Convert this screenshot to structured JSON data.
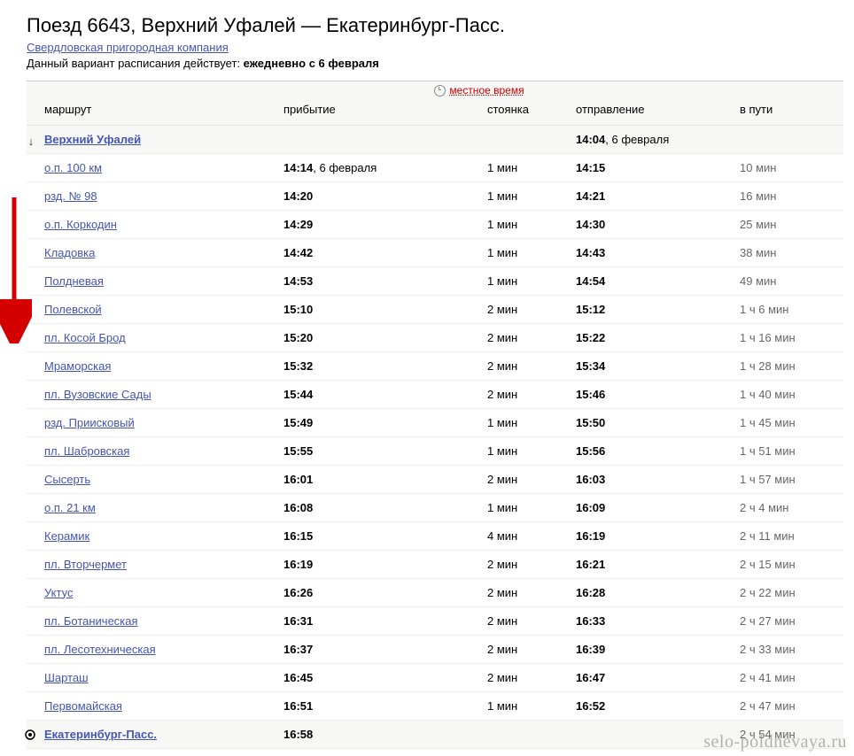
{
  "title": "Поезд 6643, Верхний Уфалей — Екатеринбург-Пасс.",
  "company": "Свердловская пригородная компания",
  "schedule_note_prefix": "Данный вариант расписания действует: ",
  "schedule_note_bold": "ежедневно с 6 февраля",
  "localtime_label": "местное время",
  "headers": {
    "route": "маршрут",
    "arrival": "прибытие",
    "stop": "стоянка",
    "departure": "отправление",
    "travel": "в пути"
  },
  "rows": [
    {
      "station": "Верхний Уфалей",
      "arrival_time": "",
      "arrival_date": "",
      "stop": "",
      "departure_time": "14:04",
      "departure_date": ", 6 февраля",
      "travel": "",
      "first": true
    },
    {
      "station": "о.п. 100 км",
      "arrival_time": "14:14",
      "arrival_date": ", 6 февраля",
      "stop": "1 мин",
      "departure_time": "14:15",
      "departure_date": "",
      "travel": "10 мин"
    },
    {
      "station": "рзд. № 98",
      "arrival_time": "14:20",
      "arrival_date": "",
      "stop": "1 мин",
      "departure_time": "14:21",
      "departure_date": "",
      "travel": "16 мин"
    },
    {
      "station": "о.п. Коркодин",
      "arrival_time": "14:29",
      "arrival_date": "",
      "stop": "1 мин",
      "departure_time": "14:30",
      "departure_date": "",
      "travel": "25 мин"
    },
    {
      "station": "Кладовка",
      "arrival_time": "14:42",
      "arrival_date": "",
      "stop": "1 мин",
      "departure_time": "14:43",
      "departure_date": "",
      "travel": "38 мин"
    },
    {
      "station": "Полдневая",
      "arrival_time": "14:53",
      "arrival_date": "",
      "stop": "1 мин",
      "departure_time": "14:54",
      "departure_date": "",
      "travel": "49 мин"
    },
    {
      "station": "Полевской",
      "arrival_time": "15:10",
      "arrival_date": "",
      "stop": "2 мин",
      "departure_time": "15:12",
      "departure_date": "",
      "travel": "1 ч 6 мин"
    },
    {
      "station": "пл. Косой Брод",
      "arrival_time": "15:20",
      "arrival_date": "",
      "stop": "2 мин",
      "departure_time": "15:22",
      "departure_date": "",
      "travel": "1 ч 16 мин"
    },
    {
      "station": "Мраморская",
      "arrival_time": "15:32",
      "arrival_date": "",
      "stop": "2 мин",
      "departure_time": "15:34",
      "departure_date": "",
      "travel": "1 ч 28 мин"
    },
    {
      "station": "пл. Вузовские Сады",
      "arrival_time": "15:44",
      "arrival_date": "",
      "stop": "2 мин",
      "departure_time": "15:46",
      "departure_date": "",
      "travel": "1 ч 40 мин"
    },
    {
      "station": "рзд. Приисковый",
      "arrival_time": "15:49",
      "arrival_date": "",
      "stop": "1 мин",
      "departure_time": "15:50",
      "departure_date": "",
      "travel": "1 ч 45 мин"
    },
    {
      "station": "пл. Шабровская",
      "arrival_time": "15:55",
      "arrival_date": "",
      "stop": "1 мин",
      "departure_time": "15:56",
      "departure_date": "",
      "travel": "1 ч 51 мин"
    },
    {
      "station": "Сысерть",
      "arrival_time": "16:01",
      "arrival_date": "",
      "stop": "2 мин",
      "departure_time": "16:03",
      "departure_date": "",
      "travel": "1 ч 57 мин"
    },
    {
      "station": "о.п. 21 км",
      "arrival_time": "16:08",
      "arrival_date": "",
      "stop": "1 мин",
      "departure_time": "16:09",
      "departure_date": "",
      "travel": "2 ч 4 мин"
    },
    {
      "station": "Керамик",
      "arrival_time": "16:15",
      "arrival_date": "",
      "stop": "4 мин",
      "departure_time": "16:19",
      "departure_date": "",
      "travel": "2 ч 11 мин"
    },
    {
      "station": "пл. Вторчермет",
      "arrival_time": "16:19",
      "arrival_date": "",
      "stop": "2 мин",
      "departure_time": "16:21",
      "departure_date": "",
      "travel": "2 ч 15 мин"
    },
    {
      "station": "Уктус",
      "arrival_time": "16:26",
      "arrival_date": "",
      "stop": "2 мин",
      "departure_time": "16:28",
      "departure_date": "",
      "travel": "2 ч 22 мин"
    },
    {
      "station": "пл. Ботаническая",
      "arrival_time": "16:31",
      "arrival_date": "",
      "stop": "2 мин",
      "departure_time": "16:33",
      "departure_date": "",
      "travel": "2 ч 27 мин"
    },
    {
      "station": "пл. Лесотехническая",
      "arrival_time": "16:37",
      "arrival_date": "",
      "stop": "2 мин",
      "departure_time": "16:39",
      "departure_date": "",
      "travel": "2 ч 33 мин"
    },
    {
      "station": "Шарташ",
      "arrival_time": "16:45",
      "arrival_date": "",
      "stop": "2 мин",
      "departure_time": "16:47",
      "departure_date": "",
      "travel": "2 ч 41 мин"
    },
    {
      "station": "Первомайская",
      "arrival_time": "16:51",
      "arrival_date": "",
      "stop": "1 мин",
      "departure_time": "16:52",
      "departure_date": "",
      "travel": "2 ч 47 мин"
    },
    {
      "station": "Екатеринбург-Пасс.",
      "arrival_time": "16:58",
      "arrival_date": "",
      "stop": "",
      "departure_time": "",
      "departure_date": "",
      "travel": "2 ч 54 мин",
      "last": true
    }
  ],
  "watermark": "selo-poldnevaya.ru"
}
